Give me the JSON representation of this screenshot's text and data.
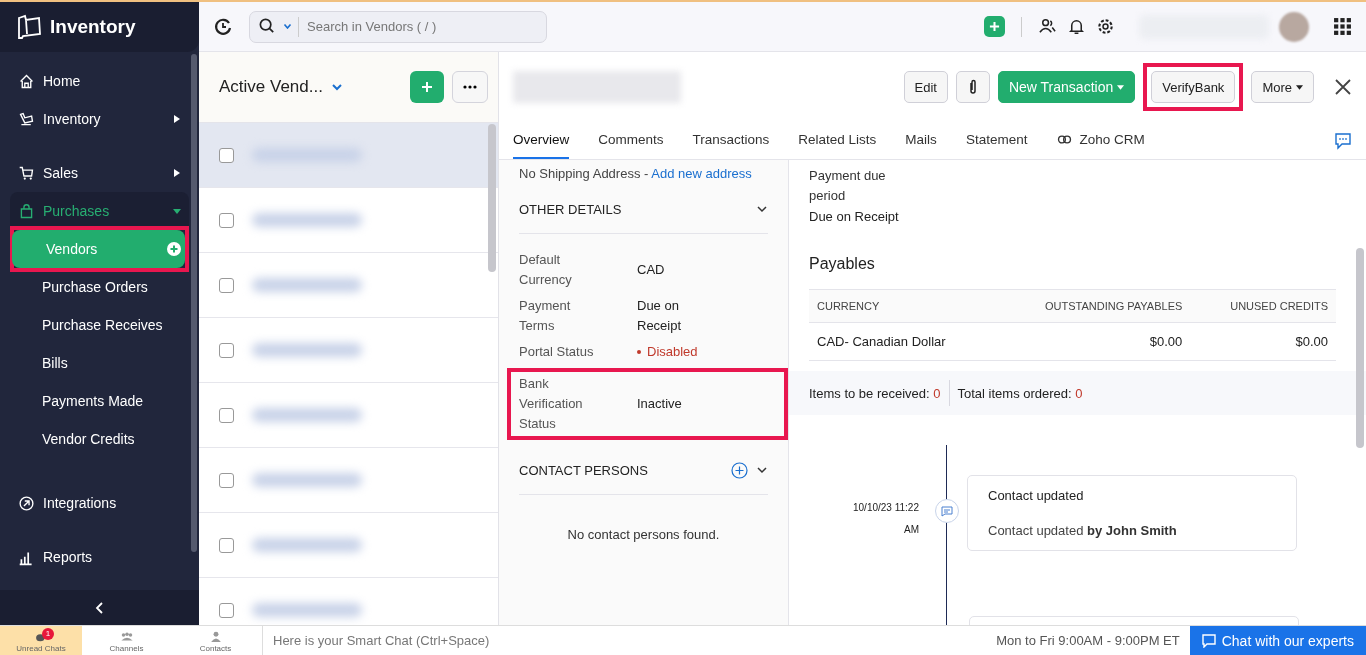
{
  "sidebar": {
    "app_title": "Inventory",
    "sections": [
      {
        "items": [
          {
            "label": "Home"
          },
          {
            "label": "Inventory",
            "expanded": false
          }
        ]
      },
      {
        "items": [
          {
            "label": "Sales",
            "expanded": false
          },
          {
            "label": "Purchases",
            "expanded": true,
            "children": [
              {
                "label": "Vendors",
                "selected": true,
                "highlighted": true
              },
              {
                "label": "Purchase Orders",
                "selected": false,
                "highlighted": false
              },
              {
                "label": "Purchase Receives",
                "selected": false,
                "highlighted": false
              },
              {
                "label": "Bills",
                "selected": false,
                "highlighted": false
              },
              {
                "label": "Payments Made",
                "selected": false,
                "highlighted": false
              },
              {
                "label": "Vendor Credits",
                "selected": false,
                "highlighted": false
              }
            ]
          }
        ]
      },
      {
        "items": [
          {
            "label": "Integrations"
          }
        ]
      },
      {
        "items": [
          {
            "label": "Reports"
          }
        ]
      }
    ]
  },
  "topbar": {
    "search": {
      "placeholder": "Search in Vendors ( / )"
    }
  },
  "list": {
    "title": "Active Vend...",
    "rows": [
      {
        "selected": true,
        "checked": false
      },
      {
        "selected": false,
        "checked": false
      },
      {
        "selected": false,
        "checked": false
      },
      {
        "selected": false,
        "checked": false
      },
      {
        "selected": false,
        "checked": false
      },
      {
        "selected": false,
        "checked": false
      },
      {
        "selected": false,
        "checked": false
      },
      {
        "selected": false,
        "checked": false
      }
    ]
  },
  "detail": {
    "actions": [
      {
        "kind": "button",
        "label": "Edit",
        "highlighted": false
      },
      {
        "kind": "attach",
        "highlighted": false
      },
      {
        "kind": "primary",
        "label": "New Transaction",
        "highlighted": false
      },
      {
        "kind": "button",
        "label": "VerifyBank",
        "highlighted": true
      },
      {
        "kind": "menu",
        "label": "More",
        "highlighted": false
      }
    ],
    "tabs": [
      {
        "label": "Overview",
        "selected": true
      },
      {
        "label": "Comments",
        "selected": false
      },
      {
        "label": "Transactions",
        "selected": false
      },
      {
        "label": "Related Lists",
        "selected": false
      },
      {
        "label": "Mails",
        "selected": false
      },
      {
        "label": "Statement",
        "selected": false
      },
      {
        "label": "Zoho CRM",
        "selected": false,
        "kind": "integration"
      }
    ],
    "shipping": {
      "text": "No Shipping Address - ",
      "link": "Add new address"
    },
    "other_details": {
      "title": "OTHER DETAILS",
      "expanded": true,
      "fields": [
        {
          "label": "Default Currency",
          "value": "CAD",
          "kind": "text",
          "highlighted": false
        },
        {
          "label": "Payment Terms",
          "value": "Due on Receipt",
          "kind": "text",
          "highlighted": false
        },
        {
          "label": "Portal Status",
          "value": "Disabled",
          "kind": "status",
          "color": "#c0392b",
          "highlighted": false
        },
        {
          "label": "Bank Verification Status",
          "value": "Inactive",
          "kind": "text",
          "highlighted": true
        }
      ]
    },
    "contact_persons": {
      "title": "CONTACT PERSONS",
      "expanded": true,
      "empty": "No contact persons found."
    },
    "payment_due": {
      "label": "Payment due period",
      "value": "Due on Receipt"
    },
    "payables": {
      "title": "Payables",
      "columns": [
        "CURRENCY",
        "OUTSTANDING PAYABLES",
        "UNUSED CREDITS"
      ],
      "rows": [
        [
          "CAD- Canadian Dollar",
          "$0.00",
          "$0.00"
        ]
      ]
    },
    "summary": [
      {
        "label": "Items to be received: ",
        "value": "0"
      },
      {
        "label": "Total items ordered: ",
        "value": "0"
      }
    ],
    "timeline": [
      {
        "date": "10/10/23 11:22 AM",
        "title": "Contact updated",
        "text": "Contact updated **by John Smith**"
      }
    ]
  },
  "bottombar": {
    "tabs": [
      {
        "label": "Unread Chats",
        "selected": true,
        "badge": "1"
      },
      {
        "label": "Channels",
        "selected": false
      },
      {
        "label": "Contacts",
        "selected": false
      }
    ],
    "chat_placeholder": "Here is your Smart Chat (Ctrl+Space)",
    "hours": "Mon to Fri 9:00AM - 9:00PM ET",
    "cta": "Chat with our experts"
  }
}
